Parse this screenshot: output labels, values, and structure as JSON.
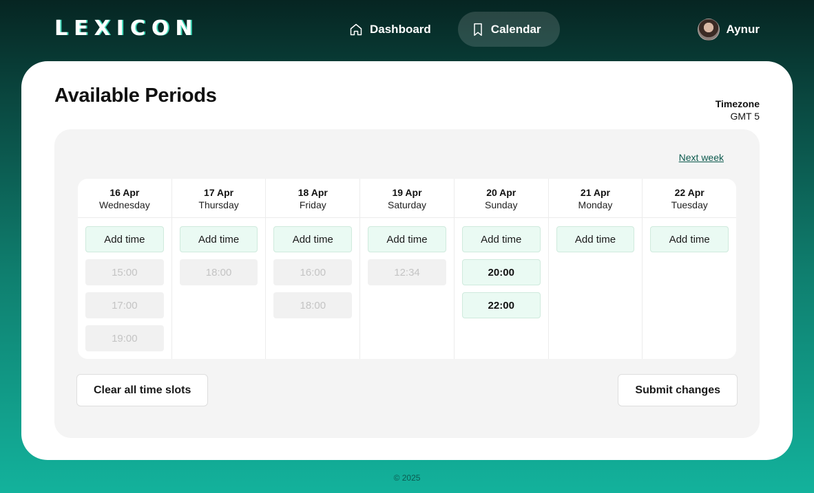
{
  "brand": {
    "logo": "LEXICON"
  },
  "nav": {
    "items": [
      {
        "label": "Dashboard",
        "icon": "home-icon",
        "active": false
      },
      {
        "label": "Calendar",
        "icon": "bookmark-icon",
        "active": true
      }
    ]
  },
  "user": {
    "name": "Aynur"
  },
  "page": {
    "title": "Available Periods"
  },
  "timezone": {
    "label": "Timezone",
    "value": "GMT 5"
  },
  "calendar": {
    "next_week_label": "Next week",
    "add_label": "Add time",
    "days": [
      {
        "date": "16 Apr",
        "weekday": "Wednesday",
        "slots": [
          {
            "time": "15:00",
            "state": "off"
          },
          {
            "time": "17:00",
            "state": "off"
          },
          {
            "time": "19:00",
            "state": "off"
          }
        ]
      },
      {
        "date": "17 Apr",
        "weekday": "Thursday",
        "slots": [
          {
            "time": "18:00",
            "state": "off"
          }
        ]
      },
      {
        "date": "18 Apr",
        "weekday": "Friday",
        "slots": [
          {
            "time": "16:00",
            "state": "off"
          },
          {
            "time": "18:00",
            "state": "off"
          }
        ]
      },
      {
        "date": "19 Apr",
        "weekday": "Saturday",
        "slots": [
          {
            "time": "12:34",
            "state": "off"
          }
        ]
      },
      {
        "date": "20 Apr",
        "weekday": "Sunday",
        "slots": [
          {
            "time": "20:00",
            "state": "on"
          },
          {
            "time": "22:00",
            "state": "on"
          }
        ]
      },
      {
        "date": "21 Apr",
        "weekday": "Monday",
        "slots": []
      },
      {
        "date": "22 Apr",
        "weekday": "Tuesday",
        "slots": []
      }
    ]
  },
  "actions": {
    "clear_label": "Clear all time slots",
    "submit_label": "Submit changes"
  },
  "footer": {
    "text": "© 2025"
  },
  "colors": {
    "accent": "#13b29c",
    "dark": "#062522",
    "slot_active_bg": "#eafaf3"
  }
}
